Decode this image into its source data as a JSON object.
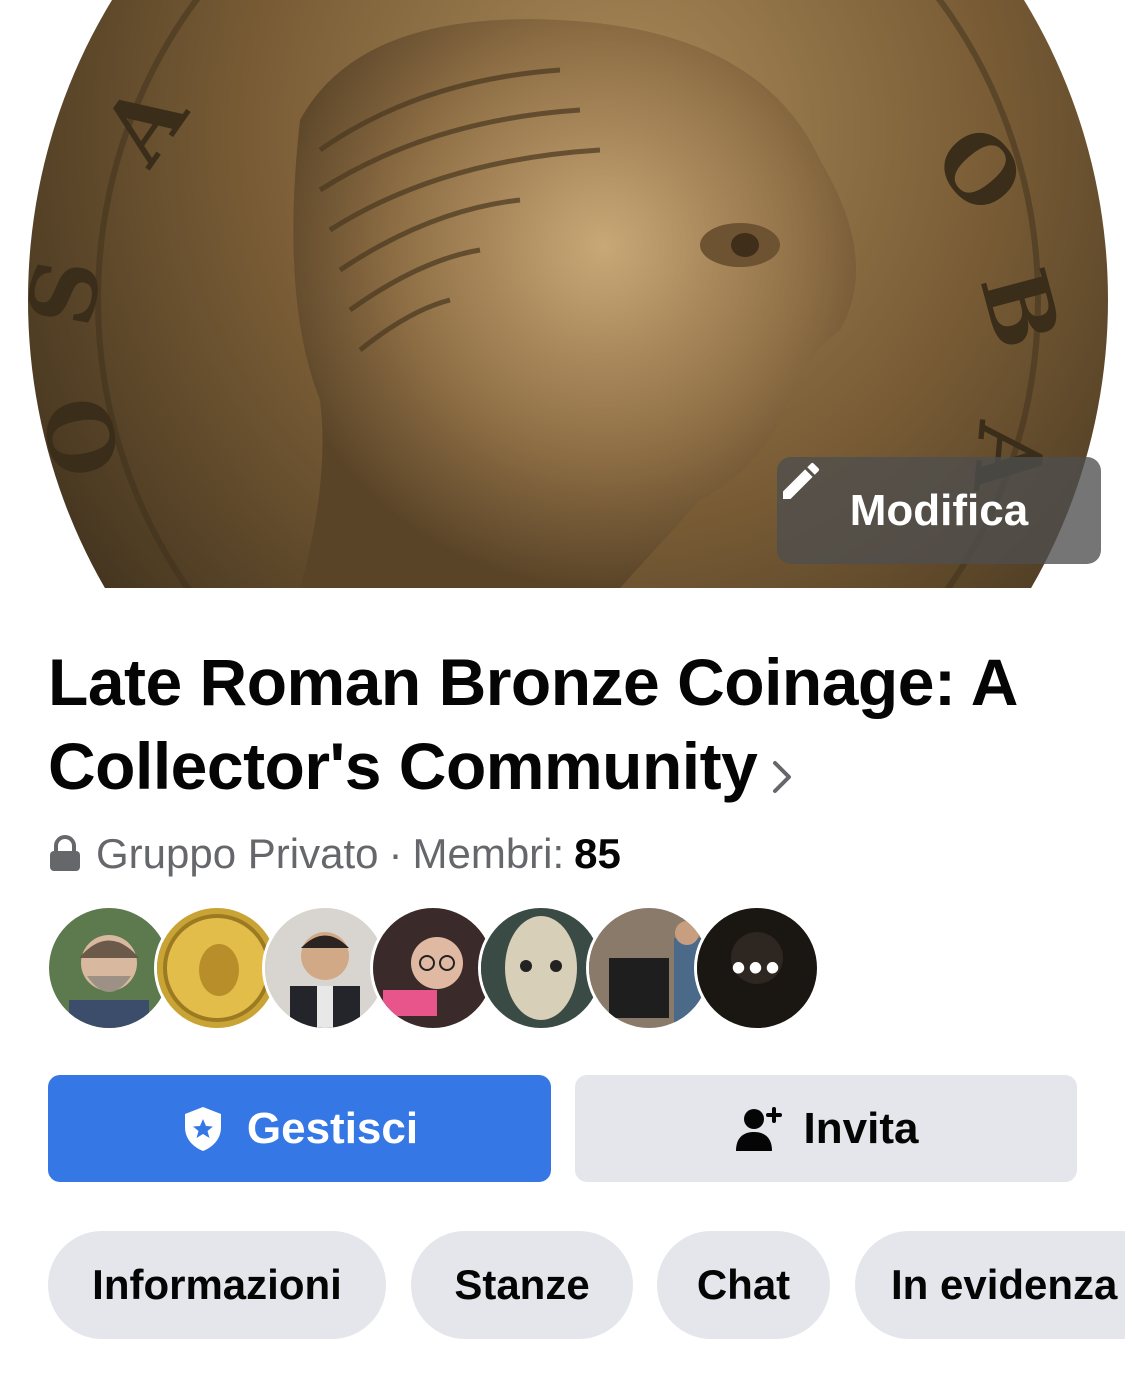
{
  "cover": {
    "edit_label": "Modifica"
  },
  "group": {
    "name": "Late Roman Bronze Coinage: A Collector's Community",
    "privacy": "Gruppo Privato",
    "separator": "·",
    "members_label": "Membri:",
    "members_count": "85"
  },
  "avatars": [
    {
      "name": "member-avatar-1"
    },
    {
      "name": "member-avatar-2"
    },
    {
      "name": "member-avatar-3"
    },
    {
      "name": "member-avatar-4"
    },
    {
      "name": "member-avatar-5"
    },
    {
      "name": "member-avatar-6"
    }
  ],
  "more_members": "•••",
  "actions": {
    "manage_label": "Gestisci",
    "invite_label": "Invita"
  },
  "tabs": [
    {
      "label": "Informazioni"
    },
    {
      "label": "Stanze"
    },
    {
      "label": "Chat"
    },
    {
      "label": "In evidenza"
    }
  ],
  "colors": {
    "primary": "#3578e5",
    "secondary_bg": "#e4e6eb",
    "text": "#050505",
    "muted": "#65676b"
  }
}
